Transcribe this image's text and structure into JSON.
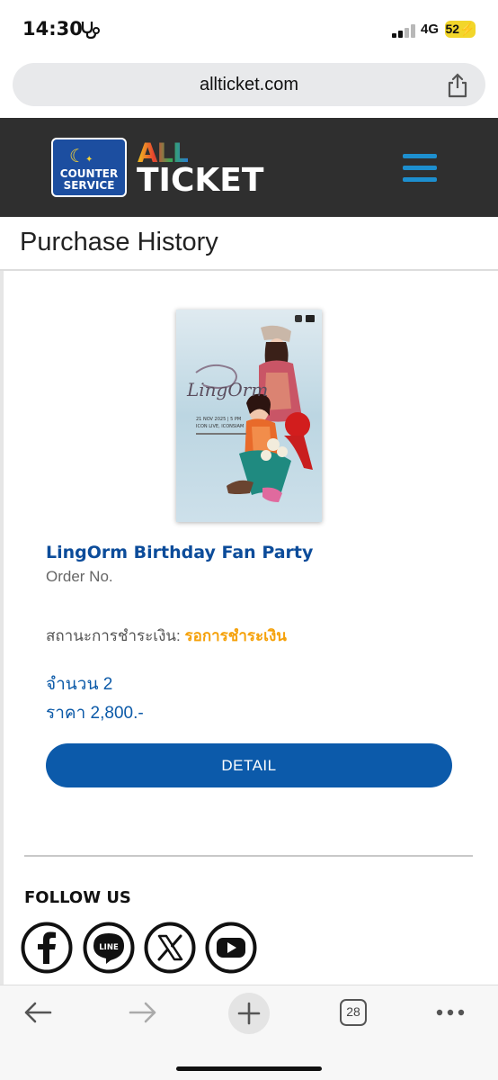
{
  "status_bar": {
    "time": "14:30",
    "network": "4G",
    "battery": "52"
  },
  "browser": {
    "url": "allticket.com",
    "tab_count": "28"
  },
  "header": {
    "counter_service_line1": "COUNTER",
    "counter_service_line2": "SERVICE",
    "brand_all": "ALL",
    "brand_ticket": "TICKET",
    "accent_color": "#1d8fcf"
  },
  "page": {
    "title": "Purchase History"
  },
  "order": {
    "event_name": "LingOrm Birthday Fan Party",
    "order_no_label": "Order No.",
    "payment_status_label": "สถานะการชำระเงิน:",
    "payment_status_value": "รอการชำระเงิน",
    "quantity": "จำนวน 2",
    "price": "ราคา 2,800.-",
    "detail_button": "DETAIL",
    "poster": {
      "title": "LingOrm",
      "date_line": "21 NOV 2025 | 5 PM",
      "venue_line": "ICON LIVE, ICONSIAM"
    }
  },
  "footer": {
    "follow_title": "FOLLOW US",
    "social_icons": [
      "facebook-icon",
      "line-icon",
      "x-icon",
      "youtube-icon"
    ],
    "social_line_label": "LINE"
  }
}
